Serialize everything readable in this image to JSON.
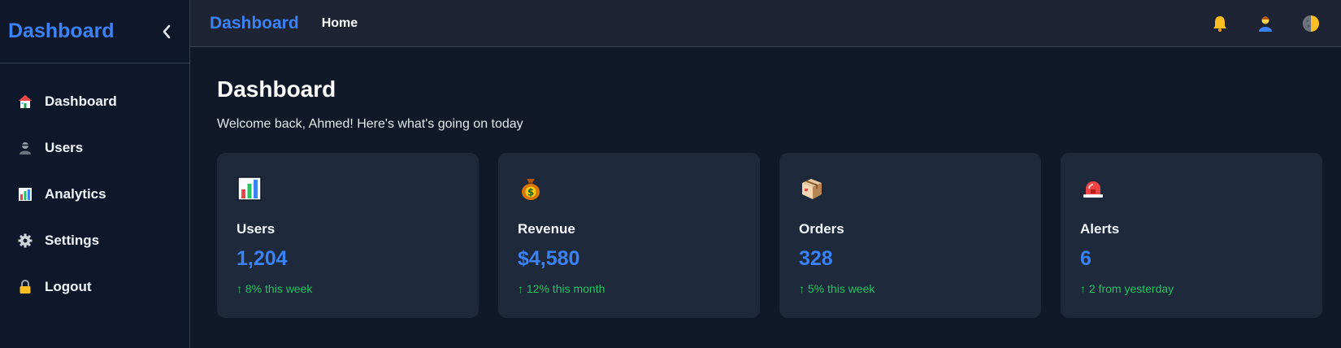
{
  "sidebar": {
    "brand": "Dashboard",
    "collapse_icon": "chevron-left-icon",
    "items": [
      {
        "label": "Dashboard",
        "icon": "house-icon"
      },
      {
        "label": "Users",
        "icon": "user-icon"
      },
      {
        "label": "Analytics",
        "icon": "bar-chart-icon"
      },
      {
        "label": "Settings",
        "icon": "gear-icon"
      },
      {
        "label": "Logout",
        "icon": "lock-icon"
      }
    ]
  },
  "topbar": {
    "brand": "Dashboard",
    "home": "Home",
    "icons": [
      "bell-icon",
      "profile-icon",
      "theme-toggle-icon"
    ]
  },
  "page": {
    "title": "Dashboard",
    "subtitle": "Welcome back, Ahmed! Here's what's going on today"
  },
  "cards": [
    {
      "label": "Users",
      "value": "1,204",
      "trend": "↑ 8% this week",
      "icon": "bar-chart-icon"
    },
    {
      "label": "Revenue",
      "value": "$4,580",
      "trend": "↑ 12% this month",
      "icon": "money-bag-icon"
    },
    {
      "label": "Orders",
      "value": "328",
      "trend": "↑ 5% this week",
      "icon": "package-icon"
    },
    {
      "label": "Alerts",
      "value": "6",
      "trend": "↑ 2 from yesterday",
      "icon": "siren-icon"
    }
  ],
  "colors": {
    "accent": "#3b82f6",
    "positive": "#22c55e",
    "sidebar_bg": "#0f172a",
    "content_bg": "#111827",
    "card_bg": "#1e293b"
  }
}
